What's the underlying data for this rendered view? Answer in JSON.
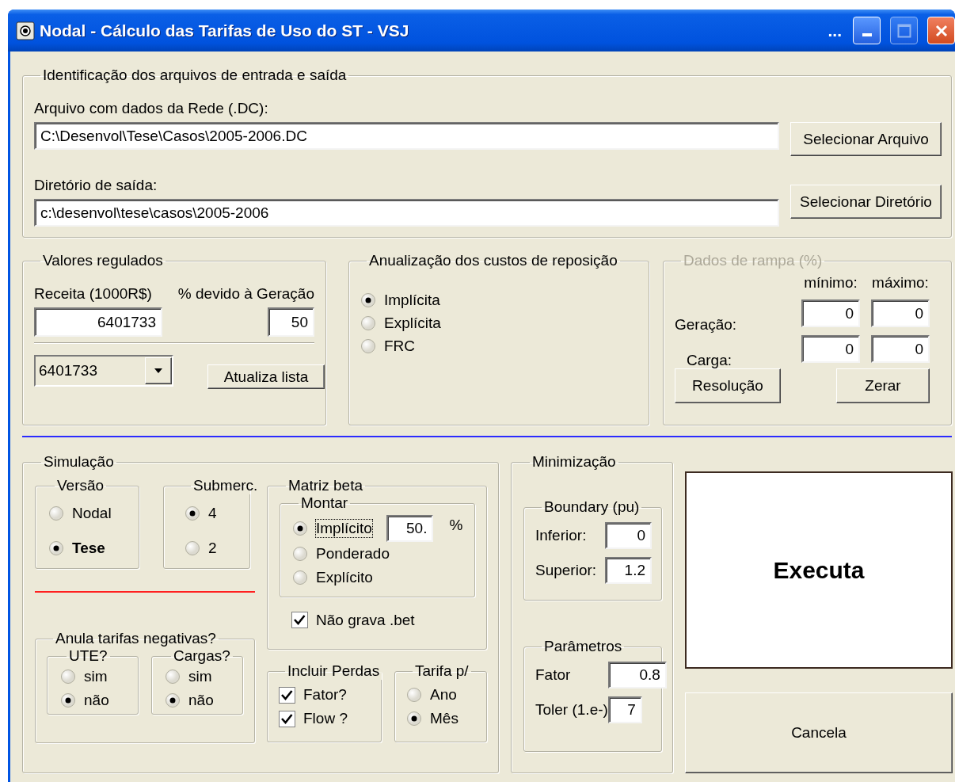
{
  "window": {
    "title": "Nodal - Cálculo das Tarifas de Uso do ST - VSJ",
    "title_extra": "..."
  },
  "files": {
    "title": "Identificação dos arquivos de entrada e saída",
    "rows": [
      {
        "label": "Arquivo com dados da Rede (.DC):",
        "value": "C:\\Desenvol\\Tese\\Casos\\2005-2006.DC",
        "button": "Selecionar Arquivo"
      },
      {
        "label": "Diretório de saída:",
        "value": "c:\\desenvol\\tese\\casos\\2005-2006",
        "button": "Selecionar Diretório"
      }
    ]
  },
  "regulated": {
    "title": "Valores regulados",
    "revenue_label": "Receita (1000R$)",
    "revenue": "6401733",
    "share_label": "% devido à Geração",
    "share": "50",
    "combo_value": "6401733",
    "update_button": "Atualiza lista"
  },
  "annualization": {
    "title": "Anualização dos custos de reposição",
    "options": [
      {
        "label": "Implícita",
        "selected": true
      },
      {
        "label": "Explícita",
        "selected": false
      },
      {
        "label": "FRC",
        "selected": false
      }
    ]
  },
  "ramp": {
    "title": "Dados de rampa (%)",
    "disabled": true,
    "columns": [
      "mínimo:",
      "máximo:"
    ],
    "rows": [
      {
        "label": "Geração:",
        "values": [
          "0",
          "0"
        ]
      },
      {
        "label": "Carga:",
        "values": [
          "0",
          "0"
        ]
      }
    ],
    "buttons": [
      "Resolução",
      "Zerar"
    ]
  },
  "simulation": {
    "title": "Simulação",
    "version": {
      "title": "Versão",
      "options": [
        {
          "label": "Nodal",
          "selected": false
        },
        {
          "label": "Tese",
          "selected": true
        }
      ]
    },
    "submarkets": {
      "title": "Submerc.",
      "options": [
        {
          "label": "4",
          "selected": true
        },
        {
          "label": "2",
          "selected": false
        }
      ]
    },
    "negative": {
      "title": "Anula tarifas negativas?",
      "groups": [
        {
          "title": "UTE?",
          "options": [
            {
              "label": "sim",
              "selected": false
            },
            {
              "label": "não",
              "selected": true
            }
          ]
        },
        {
          "title": "Cargas?",
          "options": [
            {
              "label": "sim",
              "selected": false
            },
            {
              "label": "não",
              "selected": true
            }
          ]
        }
      ]
    },
    "beta": {
      "title": "Matriz beta",
      "build": {
        "title": "Montar",
        "options": [
          {
            "label": "Implícito",
            "selected": true,
            "focused": true
          },
          {
            "label": "Ponderado",
            "selected": false,
            "focused": false
          },
          {
            "label": "Explícito",
            "selected": false,
            "focused": false
          }
        ],
        "percent": "50.",
        "percent_unit": "%"
      },
      "no_save": {
        "label": "Não grava .bet",
        "checked": true
      }
    },
    "losses": {
      "title": "Incluir Perdas",
      "items": [
        {
          "label": "Fator?",
          "checked": true
        },
        {
          "label": "Flow ?",
          "checked": true
        }
      ]
    },
    "tariff": {
      "title": "Tarifa p/",
      "options": [
        {
          "label": "Ano",
          "selected": false
        },
        {
          "label": "Mês",
          "selected": true
        }
      ]
    }
  },
  "minimization": {
    "title": "Minimização",
    "boundary": {
      "title": "Boundary (pu)",
      "fields": [
        {
          "label": "Inferior:",
          "value": "0"
        },
        {
          "label": "Superior:",
          "value": "1.2"
        }
      ]
    },
    "parameters": {
      "title": "Parâmetros",
      "fields": [
        {
          "label": "Fator",
          "value": "0.8"
        },
        {
          "label": "Toler (1.e-)",
          "value": "7"
        }
      ]
    }
  },
  "actions": [
    {
      "label": "Executa",
      "default": true
    },
    {
      "label": "Cancela",
      "default": false
    }
  ]
}
